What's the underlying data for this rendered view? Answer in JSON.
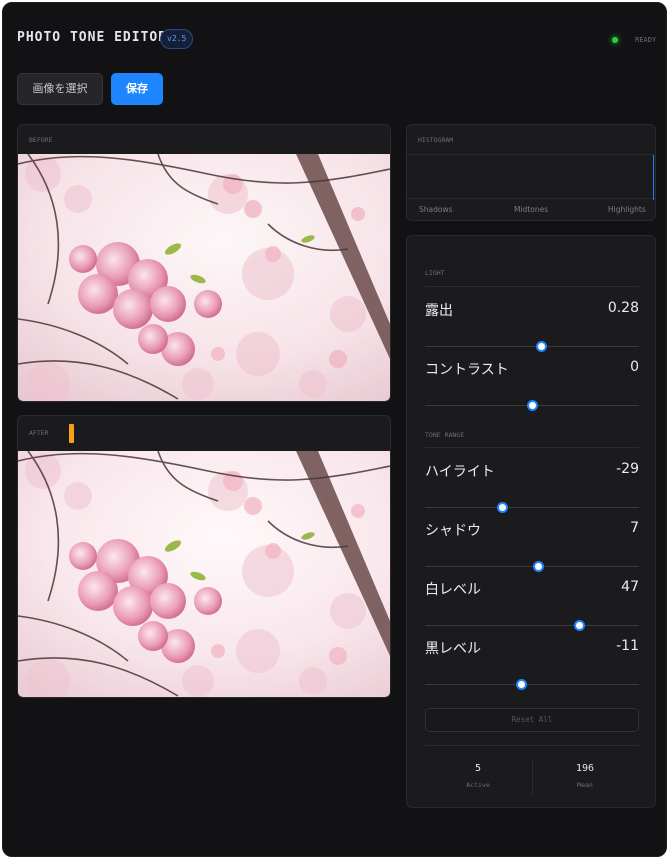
{
  "header": {
    "title": "PHOTO TONE EDITOR",
    "version": "v2.5",
    "status": "READY",
    "status_color": "#2ecc40"
  },
  "toolbar": {
    "select_image_label": "画像を選択",
    "save_label": "保存",
    "accent_color": "#1d86ff"
  },
  "before": {
    "label": "BEFORE"
  },
  "after": {
    "label": "AFTER",
    "marker_color": "#f4a317"
  },
  "histogram": {
    "label": "HISTOGRAM",
    "axis_labels": [
      "Shadows",
      "Midtones",
      "Highlights"
    ]
  },
  "controls": {
    "light_section": "LIGHT",
    "tone_section": "TONE RANGE",
    "sliders": [
      {
        "label": "露出",
        "value": "0.28",
        "position": 0.54
      },
      {
        "label": "コントラスト",
        "value": "0",
        "position": 0.5
      },
      {
        "label": "ハイライト",
        "value": "-29",
        "position": 0.36
      },
      {
        "label": "シャドウ",
        "value": "7",
        "position": 0.53
      },
      {
        "label": "白レベル",
        "value": "47",
        "position": 0.72
      },
      {
        "label": "黒レベル",
        "value": "-11",
        "position": 0.45
      }
    ],
    "reset_label": "Reset All",
    "stats": [
      {
        "value": "5",
        "label": "Active"
      },
      {
        "value": "196",
        "label": "Mean"
      }
    ]
  }
}
